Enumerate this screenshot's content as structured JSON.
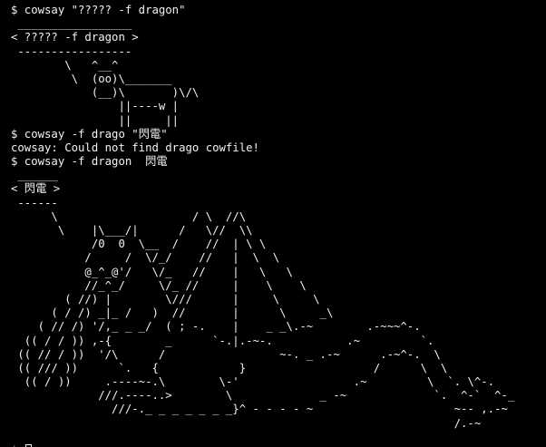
{
  "terminal": {
    "lines": [
      "$ cowsay \"????? -f dragon\"",
      " _________________",
      "< ????? -f dragon >",
      " -----------------",
      "        \\   ^__^",
      "         \\  (oo)\\_______",
      "            (__)\\       )\\/\\",
      "                ||----w |",
      "                ||     ||",
      "$ cowsay -f drago \"閃電\"",
      "cowsay: Could not find drago cowfile!",
      "$ cowsay -f dragon  閃電",
      " ______",
      "< 閃電 >",
      " ------",
      "      \\                    / \\  //\\",
      "       \\    |\\___/|      /   \\//  \\\\",
      "            /0  0  \\__  /    //  | \\ \\",
      "           /     /  \\/_/    //   |  \\  \\",
      "           @_^_@'/   \\/_   //    |   \\   \\",
      "           //_^_/     \\/_ //     |    \\    \\",
      "        ( //) |        \\///      |     \\     \\",
      "      ( / /) _|_ /   )  //       |      \\     _\\",
      "    ( // /) '/,_ _ _/  ( ; -.    |    _ _\\.-~        .-~~~^-.",
      "  (( / / )) ,-{        _      `-.|.-~-.           .~         `.",
      " (( // / ))  '/\\      /                 ~-. _ .-~      .-~^-.  \\",
      " (( /// ))      `.   {            }                   /      \\  \\",
      "  (( / ))     .----~-.\\        \\-'                 .~         \\  `. \\^-.",
      "             ///.----..>        \\             _ -~             `.  ^-`  ^-_",
      "               ///-._ _ _ _ _ _ _}^ - - - - ~                     ~-- ,.-~",
      "                                                                  /.-~"
    ],
    "blank_after_art": "",
    "final_prompt": "$ "
  }
}
